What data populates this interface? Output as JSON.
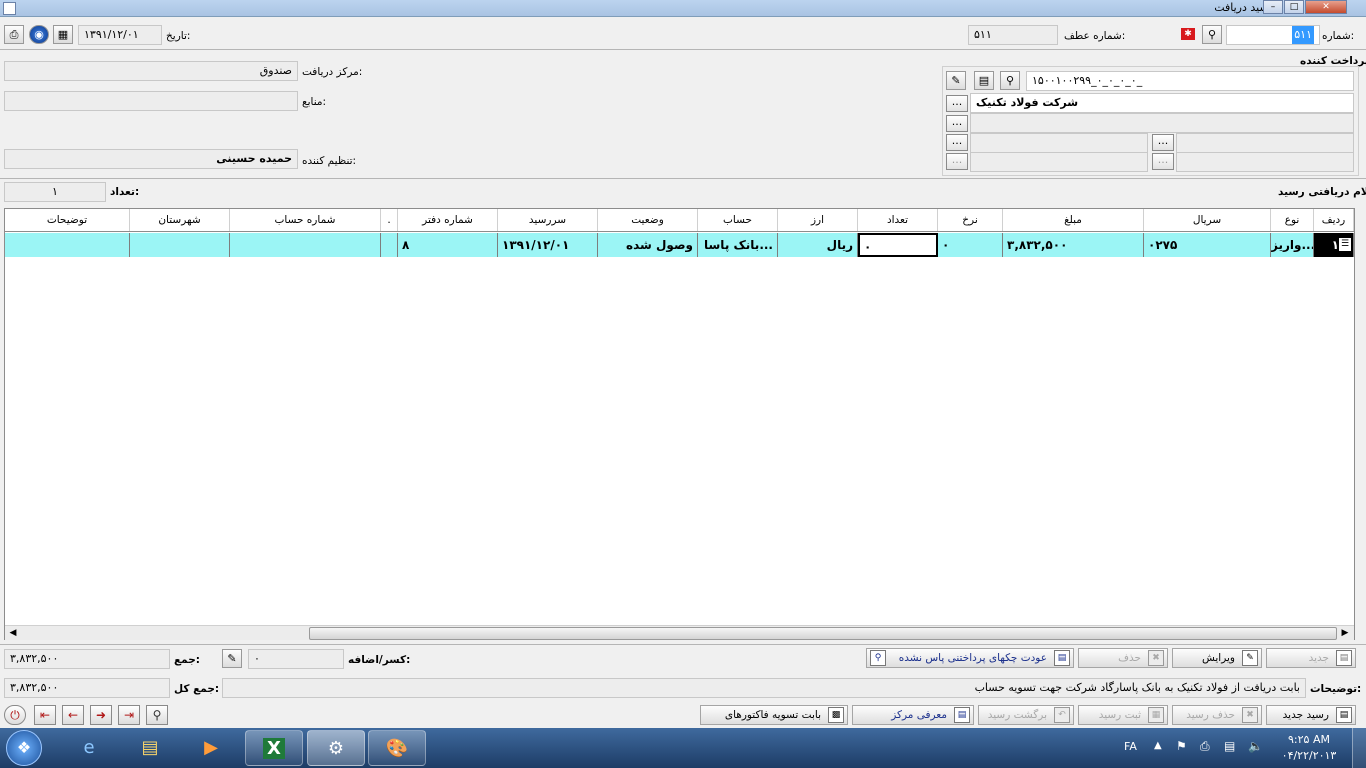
{
  "window": {
    "title": "رسید دریافت",
    "controls": {
      "minimize": "–",
      "maximize": "□",
      "close": "✕"
    }
  },
  "header": {
    "number_label": "شماره:",
    "number_value": "۵۱۱",
    "ref_number_label": "شماره عطف:",
    "ref_number_value": "۵۱۱",
    "date_label": "تاریخ:",
    "date_value": "۱۳۹۱/۱۲/۰۱"
  },
  "payer": {
    "label": "پرداخت کننده",
    "code": "۱۵۰۰۱۰۰۲۹۹_۰_۰_۰_۰_",
    "name": "شرکت فولاد تکنیک",
    "dots": "..."
  },
  "receive_center": {
    "label": "مرکز دریافت:",
    "value": "صندوق"
  },
  "source": {
    "label": "منابع:",
    "value": ""
  },
  "arranger": {
    "label": "تنظیم کننده:",
    "value": "حمیده حسینی"
  },
  "items_section": {
    "label": "اقلام دریافتی رسید:",
    "count_label": "تعداد:",
    "count_value": "۱"
  },
  "grid": {
    "columns": [
      "ردیف",
      "نوع",
      "سریال",
      "مبلغ",
      "نرخ",
      "تعداد",
      "ارز",
      "حساب",
      "وضعیت",
      "سررسید",
      "شماره دفتر",
      ".",
      "شماره حساب",
      "شهرستان",
      "توضیحات"
    ],
    "rows": [
      {
        "row": "۱",
        "type": "واریز...",
        "serial": "۰۲۷۵",
        "amount": "۳,۸۳۲,۵۰۰",
        "rate": "۰",
        "qty": "۰",
        "currency": "ریال",
        "account": "بانک پاسا...",
        "status": "وصول شده",
        "due": "۱۳۹۱/۱۲/۰۱",
        "book_no": "۸",
        "dot": "",
        "account_no": "",
        "city": "",
        "desc": ""
      }
    ]
  },
  "totals": {
    "discount_label": "کسر/اضافه:",
    "discount_value": "۰",
    "sum_label": "جمع:",
    "sum_value": "۳,۸۳۲,۵۰۰",
    "grand_label": "جمع کل:",
    "grand_value": "۳,۸۳۲,۵۰۰",
    "desc_label": "توضیحات:",
    "desc_value": "بابت دریافت از فولاد تکنیک به بانک پاسارگاد شرکت جهت تسویه حساب"
  },
  "buttons": {
    "new": "جدید",
    "edit": "ویرایش",
    "delete": "حذف",
    "return_cheques": "عودت چکهای پرداختنی پاس نشده",
    "new_receipt": "رسید جدید",
    "delete_receipt": "حذف رسید",
    "save_receipt": "ثبت رسید",
    "return_receipt": "برگشت رسید",
    "introduce_center": "معرفی مرکز",
    "settle_invoices": "بابت تسویه فاکتورهای"
  },
  "taskbar": {
    "language": "FA",
    "time": "۹:۲۵ AM",
    "date": "۰۴/۲۲/۲۰۱۳",
    "start_icon": "windows-orb-icon",
    "colors": {
      "taskbar": "#2a4c7a",
      "row_highlight": "#9bf5f5"
    }
  }
}
